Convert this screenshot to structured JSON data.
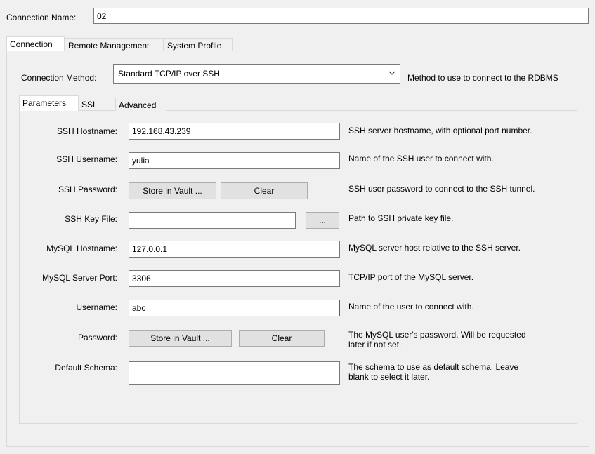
{
  "connection_name": {
    "label": "Connection Name:",
    "value": "02"
  },
  "main_tabs": [
    {
      "label": "Connection",
      "active": true
    },
    {
      "label": "Remote Management",
      "active": false
    },
    {
      "label": "System Profile",
      "active": false
    }
  ],
  "method": {
    "label": "Connection Method:",
    "value": "Standard TCP/IP over SSH",
    "description": "Method to use to connect to the RDBMS"
  },
  "sub_tabs": [
    {
      "label": "Parameters",
      "active": true
    },
    {
      "label": "SSL",
      "active": false
    },
    {
      "label": "Advanced",
      "active": false
    }
  ],
  "fields": {
    "ssh_hostname": {
      "label": "SSH Hostname:",
      "value": "192.168.43.239",
      "description": "SSH server hostname, with  optional port number."
    },
    "ssh_username": {
      "label": "SSH Username:",
      "value": "yulia",
      "description": "Name of the SSH user to connect with."
    },
    "ssh_password": {
      "label": "SSH Password:",
      "store_label": "Store in Vault ...",
      "clear_label": "Clear",
      "description": "SSH user password to connect to the SSH tunnel."
    },
    "ssh_key_file": {
      "label": "SSH Key File:",
      "value": "",
      "browse_label": "...",
      "description": "Path to SSH private key file."
    },
    "mysql_hostname": {
      "label": "MySQL Hostname:",
      "value": "127.0.0.1",
      "description": "MySQL server host relative to the SSH server."
    },
    "mysql_port": {
      "label": "MySQL Server Port:",
      "value": "3306",
      "description": "TCP/IP port of the MySQL server."
    },
    "username": {
      "label": "Username:",
      "value": "abc",
      "description": "Name of the user to connect with."
    },
    "password": {
      "label": "Password:",
      "store_label": "Store in Vault ...",
      "clear_label": "Clear",
      "description_line1": "The MySQL user's password. Will be requested",
      "description_line2": "later if not set."
    },
    "default_schema": {
      "label": "Default Schema:",
      "value": "",
      "description_line1": "The schema to use as default schema. Leave",
      "description_line2": "blank to select it later."
    }
  }
}
